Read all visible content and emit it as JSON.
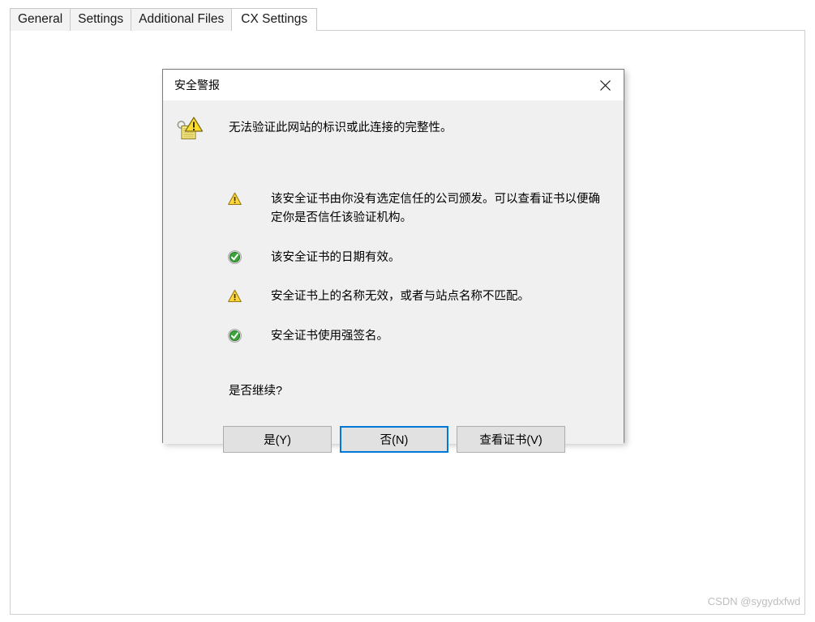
{
  "window": {
    "tabs": [
      {
        "label": "General",
        "active": false
      },
      {
        "label": "Settings",
        "active": false
      },
      {
        "label": "Additional Files",
        "active": false
      },
      {
        "label": "CX Settings",
        "active": true
      }
    ]
  },
  "dialog": {
    "title": "安全警报",
    "close_label": "×",
    "headline": "无法验证此网站的标识或此连接的完整性。",
    "main_icon": "certificate-warning-icon",
    "items": [
      {
        "icon": "warning-triangle-icon",
        "status": "warning",
        "text": "该安全证书由你没有选定信任的公司颁发。可以查看证书以便确定你是否信任该验证机构。"
      },
      {
        "icon": "check-circle-icon",
        "status": "ok",
        "text": "该安全证书的日期有效。"
      },
      {
        "icon": "warning-triangle-icon",
        "status": "warning",
        "text": "安全证书上的名称无效，或者与站点名称不匹配。"
      },
      {
        "icon": "check-circle-icon",
        "status": "ok",
        "text": "安全证书使用强签名。"
      }
    ],
    "question": "是否继续?",
    "buttons": {
      "yes": "是(Y)",
      "no": "否(N)",
      "view_certificate": "查看证书(V)"
    }
  },
  "watermark": "CSDN @sygydxfwd",
  "colors": {
    "focus_border": "#0078d7",
    "warning_yellow": "#ffd93b",
    "ok_green": "#3aa33a",
    "dialog_bg": "#f0f0f0",
    "button_bg": "#e1e1e1"
  }
}
